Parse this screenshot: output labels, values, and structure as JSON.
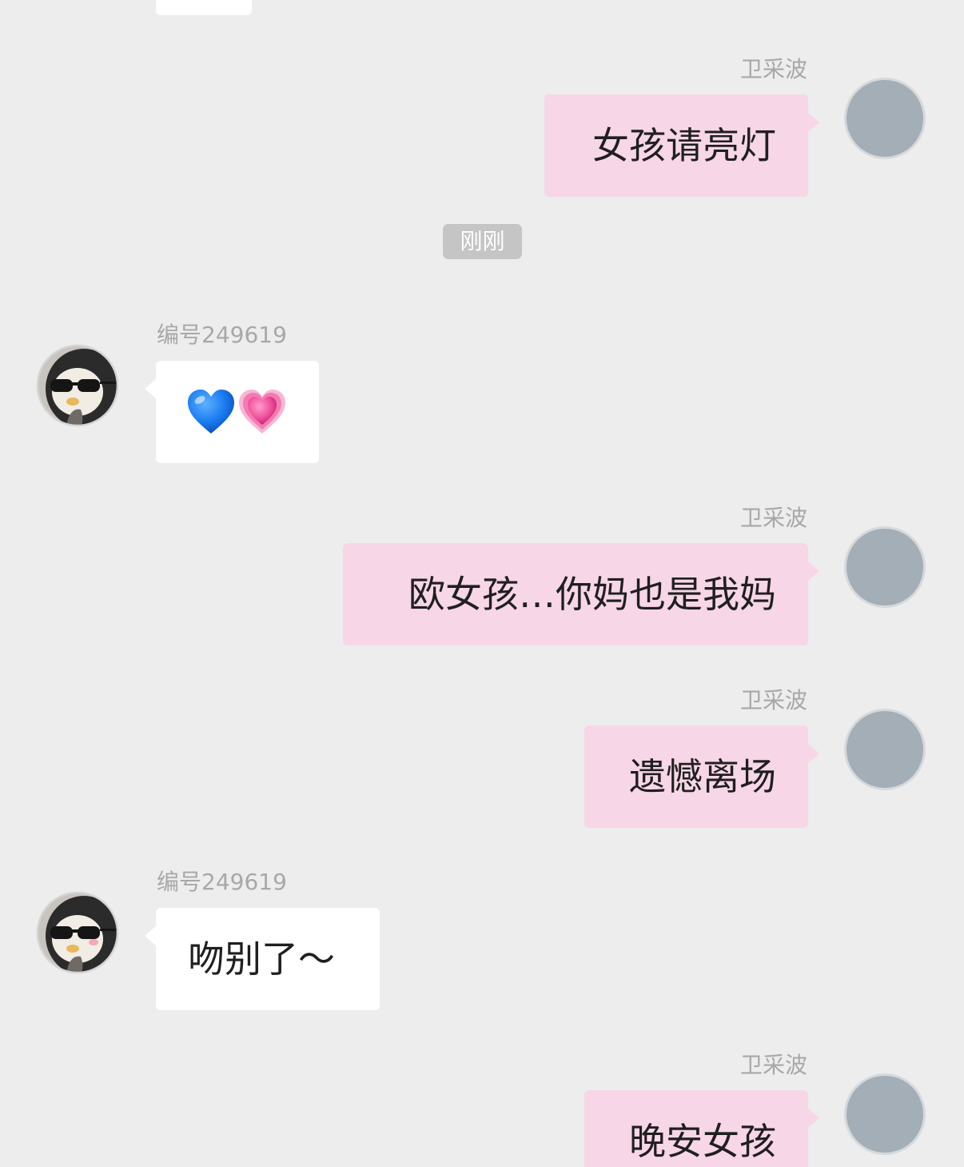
{
  "chat": {
    "timestamp": "刚刚",
    "messages": [
      {
        "sender": "卫采波",
        "side": "right",
        "text": "女孩请亮灯"
      },
      {
        "sender": "编号249619",
        "side": "left",
        "text": "",
        "emoji": [
          "blue-heart",
          "growing-pink-heart"
        ]
      },
      {
        "sender": "卫采波",
        "side": "right",
        "text": "欧女孩…你妈也是我妈"
      },
      {
        "sender": "卫采波",
        "side": "right",
        "text": "遗憾离场"
      },
      {
        "sender": "编号249619",
        "side": "left",
        "text": "吻别了～"
      },
      {
        "sender": "卫采波",
        "side": "right",
        "text": "晚安女孩"
      }
    ]
  },
  "theme": {
    "background": "#ededed",
    "my_bubble_color": "#f7d6e7",
    "their_bubble_color": "#ffffff",
    "grey_avatar_color": "#a4aeb6",
    "timestamp_pill_color": "#c5c5c5",
    "blue_heart_color": "#1a7cf0",
    "pink_heart_color": "#ee4f9c"
  }
}
